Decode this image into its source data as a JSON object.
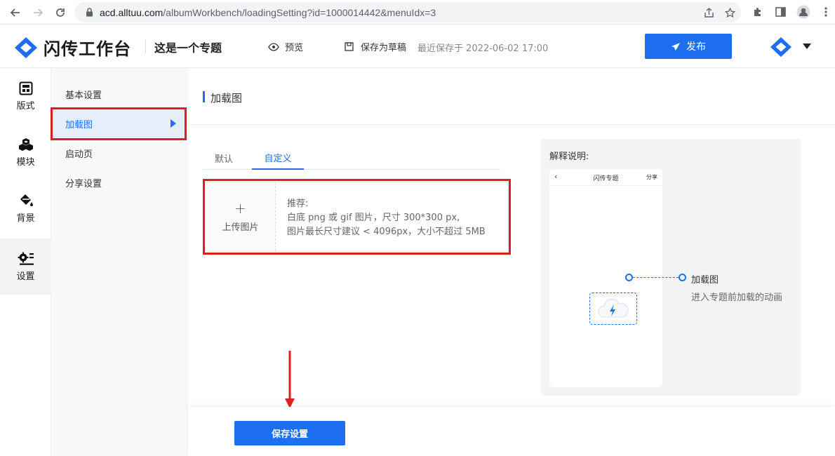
{
  "browser": {
    "url_host": "acd.alltuu.com",
    "url_path": "/albumWorkbench/loadingSetting?id=1000014442&menuIdx=3",
    "icons": [
      "back-arrow-icon",
      "forward-arrow-icon",
      "reload-icon",
      "lock-icon",
      "share-icon",
      "star-icon",
      "extensions-icon",
      "sidebar-icon",
      "profile-icon",
      "more-icon"
    ]
  },
  "header": {
    "brand": "闪传工作台",
    "project_title": "这是一个专题",
    "preview_label": "预览",
    "save_draft_label": "保存为草稿",
    "last_saved": "最近保存于 2022-06-02 17:00",
    "publish_label": "发布",
    "accent_color": "#1d6ff0"
  },
  "rail": {
    "items": [
      {
        "label": "版式",
        "icon": "layout-icon"
      },
      {
        "label": "模块",
        "icon": "modules-icon"
      },
      {
        "label": "背景",
        "icon": "paint-bucket-icon"
      },
      {
        "label": "设置",
        "icon": "settings-icon",
        "active": true
      }
    ]
  },
  "submenu": {
    "items": [
      {
        "label": "基本设置"
      },
      {
        "label": "加载图",
        "active": true
      },
      {
        "label": "启动页"
      },
      {
        "label": "分享设置"
      }
    ]
  },
  "main": {
    "section_title": "加载图",
    "tabs": [
      {
        "label": "默认"
      },
      {
        "label": "自定义",
        "active": true
      }
    ],
    "upload": {
      "button_label": "上传图片",
      "tips_title": "推荐:",
      "tips_line1": "白底 png 或 gif 图片，尺寸 300*300 px,",
      "tips_line2": "图片最长尺寸建议 < 4096px，大小不超过 5MB"
    },
    "explain": {
      "title": "解释说明:",
      "phone_title": "闪传专题",
      "phone_share": "分享",
      "annotation_title": "加载图",
      "annotation_sub": "进入专题前加载的动画"
    }
  },
  "footer": {
    "save_label": "保存设置"
  },
  "highlight_color": "#e02020"
}
